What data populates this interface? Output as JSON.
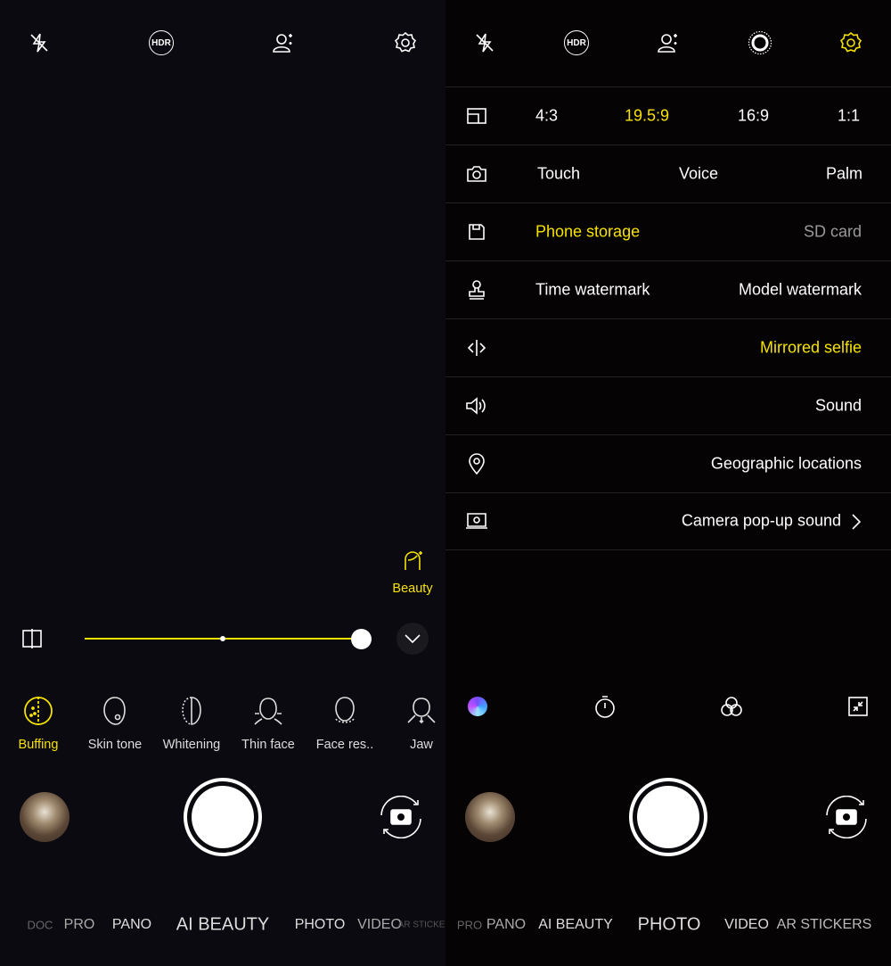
{
  "colors": {
    "accent": "#f6e200",
    "background": "#0a090d"
  },
  "left": {
    "top_icons": [
      "flash-off-icon",
      "hdr-icon",
      "portrait-plus-icon",
      "settings-icon"
    ],
    "hdr_label": "HDR",
    "beauty_label": "Beauty",
    "slider_value": 1.0,
    "beauty_items": [
      {
        "label": "Buffing",
        "icon": "buffing-icon",
        "active": true
      },
      {
        "label": "Skin tone",
        "icon": "skin-tone-icon"
      },
      {
        "label": "Whitening",
        "icon": "whitening-icon"
      },
      {
        "label": "Thin face",
        "icon": "thin-face-icon"
      },
      {
        "label": "Face res..",
        "icon": "face-reshape-icon"
      },
      {
        "label": "Jaw",
        "icon": "jaw-icon"
      }
    ],
    "modes": [
      "DOC",
      "PRO",
      "PANO",
      "AI BEAUTY",
      "PHOTO",
      "VIDEO",
      "AR STICKERS",
      "DOC"
    ],
    "active_mode": "AI BEAUTY"
  },
  "right": {
    "top_icons": [
      "flash-off-icon",
      "hdr-icon",
      "portrait-plus-icon",
      "live-photo-icon",
      "settings-icon"
    ],
    "hdr_label": "HDR",
    "settings": {
      "aspect": {
        "options": [
          "4:3",
          "19.5:9",
          "16:9",
          "1:1"
        ],
        "selected": "19.5:9"
      },
      "shutter": {
        "options": [
          "Touch",
          "Voice",
          "Palm"
        ]
      },
      "storage": {
        "options": [
          "Phone storage",
          "SD card"
        ],
        "selected": "Phone storage"
      },
      "watermark": {
        "options": [
          "Time watermark",
          "Model watermark"
        ]
      },
      "mirrored_selfie": "Mirrored selfie",
      "sound": "Sound",
      "geo": "Geographic locations",
      "popup_sound": "Camera pop-up sound"
    },
    "toolbar_icons": [
      "color-filter-icon",
      "timer-icon",
      "filters-icon",
      "collapse-icon"
    ],
    "modes": [
      "PRO",
      "PANO",
      "AI BEAUTY",
      "PHOTO",
      "VIDEO",
      "AR STICKERS"
    ],
    "active_mode": "PHOTO"
  }
}
